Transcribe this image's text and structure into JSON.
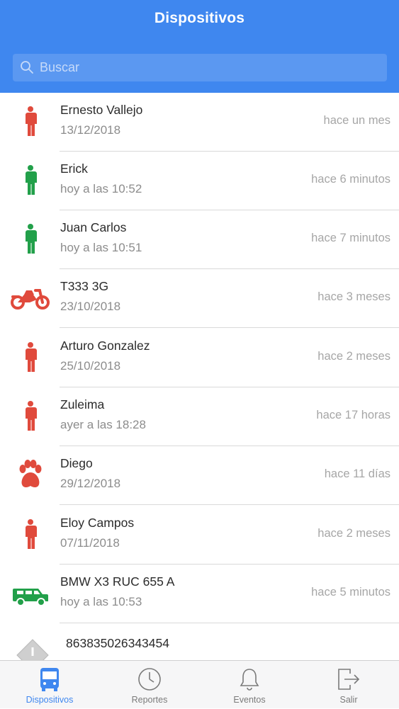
{
  "header": {
    "title": "Dispositivos"
  },
  "search": {
    "placeholder": "Buscar",
    "value": ""
  },
  "devices": [
    {
      "name": "Ernesto Vallejo",
      "date": "13/12/2018",
      "ago": "hace un mes",
      "icon": "person-icon",
      "color": "#e04a3c"
    },
    {
      "name": "Erick",
      "date": "hoy a las 10:52",
      "ago": "hace 6 minutos",
      "icon": "person-icon",
      "color": "#22a04a"
    },
    {
      "name": "Juan Carlos",
      "date": "hoy a las 10:51",
      "ago": "hace 7 minutos",
      "icon": "person-icon",
      "color": "#22a04a"
    },
    {
      "name": "T333 3G",
      "date": "23/10/2018",
      "ago": "hace 3 meses",
      "icon": "motorcycle-icon",
      "color": "#e04a3c"
    },
    {
      "name": "Arturo Gonzalez",
      "date": "25/10/2018",
      "ago": "hace 2 meses",
      "icon": "person-icon",
      "color": "#e04a3c"
    },
    {
      "name": "Zuleima",
      "date": "ayer a las 18:28",
      "ago": "hace 17 horas",
      "icon": "person-icon",
      "color": "#e04a3c"
    },
    {
      "name": "Diego",
      "date": "29/12/2018",
      "ago": "hace 11 días",
      "icon": "paw-icon",
      "color": "#e04a3c"
    },
    {
      "name": "Eloy Campos",
      "date": "07/11/2018",
      "ago": "hace 2 meses",
      "icon": "person-icon",
      "color": "#e04a3c"
    },
    {
      "name": "BMW X3 RUC 655 A",
      "date": "hoy a las 10:53",
      "ago": "hace 5 minutos",
      "icon": "suv-icon",
      "color": "#22a04a"
    },
    {
      "name": "863835026343454",
      "date": "",
      "ago": "",
      "icon": "warning-icon",
      "color": "#cfcfcf"
    }
  ],
  "tabs": [
    {
      "label": "Dispositivos",
      "icon": "bus-icon",
      "active": true
    },
    {
      "label": "Reportes",
      "icon": "clock-icon",
      "active": false
    },
    {
      "label": "Eventos",
      "icon": "bell-icon",
      "active": false
    },
    {
      "label": "Salir",
      "icon": "logout-icon",
      "active": false
    }
  ],
  "colors": {
    "header": "#3f87ef",
    "active_tab": "#3f87ef",
    "inactive_tab": "#7a7a7a"
  }
}
